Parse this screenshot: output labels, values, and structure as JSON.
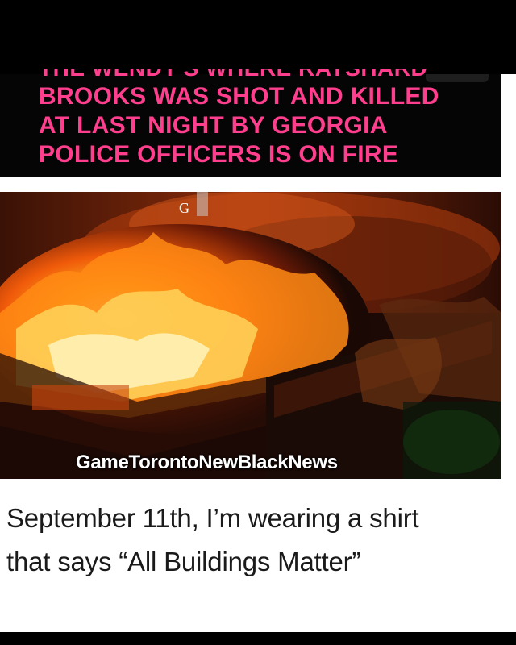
{
  "headline": {
    "cut_line": "THE WENDY'S WHERE RAYSHARD",
    "lines": [
      "BROOKS WAS SHOT AND KILLED",
      "AT LAST NIGHT BY GEORGIA",
      "POLICE OFFICERS IS ON FIRE"
    ],
    "color": "#ff3f8e"
  },
  "image": {
    "watermark": "G",
    "source_tag": "GameTorontoNewBlackNews"
  },
  "tweet": {
    "lines": [
      "September 11th, I’m wearing a shirt",
      "that says “All Buildings Matter”"
    ]
  }
}
